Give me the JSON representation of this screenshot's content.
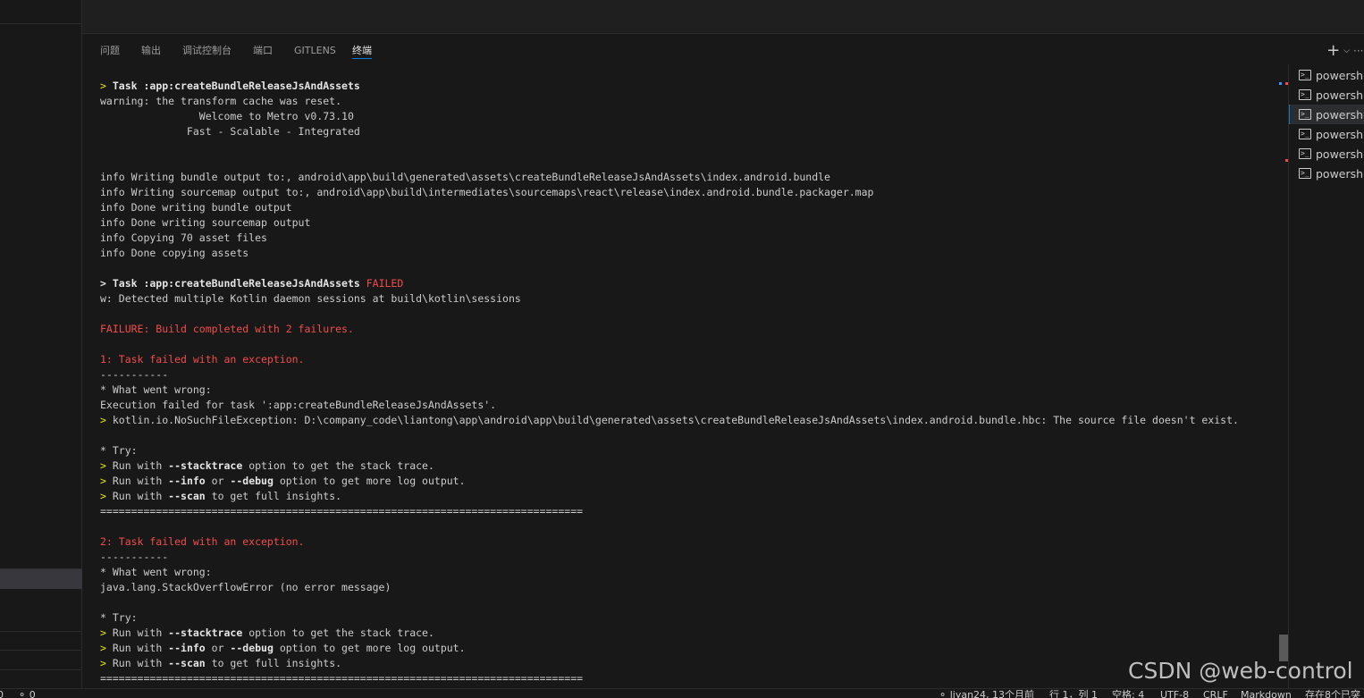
{
  "panel": {
    "tabs": [
      {
        "label": "问题"
      },
      {
        "label": "输出"
      },
      {
        "label": "调试控制台"
      },
      {
        "label": "端口"
      },
      {
        "label": "GITLENS"
      },
      {
        "label": "终端",
        "active": true
      }
    ],
    "actions": {
      "new_terminal": "+",
      "dropdown": "⌵",
      "more": "···"
    }
  },
  "terminal": {
    "lines": [
      [
        {
          "t": "> ",
          "c": "y"
        },
        {
          "t": "Task :app:createBundleReleaseJsAndAssets",
          "c": "b"
        }
      ],
      [
        {
          "t": "warning: the transform cache was reset."
        }
      ],
      [
        {
          "t": "                Welcome to Metro v0.73.10"
        }
      ],
      [
        {
          "t": "              Fast - Scalable - Integrated"
        }
      ],
      [],
      [],
      [
        {
          "t": "info Writing bundle output to:, android\\app\\build\\generated\\assets\\createBundleReleaseJsAndAssets\\index.android.bundle"
        }
      ],
      [
        {
          "t": "info Writing sourcemap output to:, android\\app\\build\\intermediates\\sourcemaps\\react\\release\\index.android.bundle.packager.map"
        }
      ],
      [
        {
          "t": "info Done writing bundle output"
        }
      ],
      [
        {
          "t": "info Done writing sourcemap output"
        }
      ],
      [
        {
          "t": "info Copying 70 asset files"
        }
      ],
      [
        {
          "t": "info Done copying assets"
        }
      ],
      [],
      [
        {
          "t": "> Task :app:createBundleReleaseJsAndAssets",
          "c": "rb"
        },
        {
          "t": " FAILED",
          "c": "r"
        }
      ],
      [
        {
          "t": "w: Detected multiple Kotlin daemon sessions at build\\kotlin\\sessions"
        }
      ],
      [],
      [
        {
          "t": "FAILURE: Build completed with 2 failures.",
          "c": "r"
        }
      ],
      [],
      [
        {
          "t": "1: Task failed with an exception.",
          "c": "r"
        }
      ],
      [
        {
          "t": "-----------"
        }
      ],
      [
        {
          "t": "* What went wrong:"
        }
      ],
      [
        {
          "t": "Execution failed for task ':app:createBundleReleaseJsAndAssets'."
        }
      ],
      [
        {
          "t": "> ",
          "c": "y"
        },
        {
          "t": "kotlin.io.NoSuchFileException: D:\\company_code\\liantong\\app\\android\\app\\build\\generated\\assets\\createBundleReleaseJsAndAssets\\index.android.bundle.hbc: The source file doesn't exist."
        }
      ],
      [],
      [
        {
          "t": "* Try:"
        }
      ],
      [
        {
          "t": "> ",
          "c": "y"
        },
        {
          "t": "Run with "
        },
        {
          "t": "--stacktrace",
          "c": "b"
        },
        {
          "t": " option to get the stack trace."
        }
      ],
      [
        {
          "t": "> ",
          "c": "y"
        },
        {
          "t": "Run with "
        },
        {
          "t": "--info",
          "c": "b"
        },
        {
          "t": " or "
        },
        {
          "t": "--debug",
          "c": "b"
        },
        {
          "t": " option to get more log output."
        }
      ],
      [
        {
          "t": "> ",
          "c": "y"
        },
        {
          "t": "Run with "
        },
        {
          "t": "--scan",
          "c": "b"
        },
        {
          "t": " to get full insights."
        }
      ],
      [
        {
          "t": "=============================================================================="
        }
      ],
      [],
      [
        {
          "t": "2: Task failed with an exception.",
          "c": "r"
        }
      ],
      [
        {
          "t": "-----------"
        }
      ],
      [
        {
          "t": "* What went wrong:"
        }
      ],
      [
        {
          "t": "java.lang.StackOverflowError (no error message)"
        }
      ],
      [],
      [
        {
          "t": "* Try:"
        }
      ],
      [
        {
          "t": "> ",
          "c": "y"
        },
        {
          "t": "Run with "
        },
        {
          "t": "--stacktrace",
          "c": "b"
        },
        {
          "t": " option to get the stack trace."
        }
      ],
      [
        {
          "t": "> ",
          "c": "y"
        },
        {
          "t": "Run with "
        },
        {
          "t": "--info",
          "c": "b"
        },
        {
          "t": " or "
        },
        {
          "t": "--debug",
          "c": "b"
        },
        {
          "t": " option to get more log output."
        }
      ],
      [
        {
          "t": "> ",
          "c": "y"
        },
        {
          "t": "Run with "
        },
        {
          "t": "--scan",
          "c": "b"
        },
        {
          "t": " to get full insights."
        }
      ],
      [
        {
          "t": "=============================================================================="
        }
      ]
    ]
  },
  "terminal_list": {
    "items": [
      {
        "label": "powershell"
      },
      {
        "label": "powershell"
      },
      {
        "label": "powershell",
        "active": true
      },
      {
        "label": "powershell"
      },
      {
        "label": "powershell"
      },
      {
        "label": "powershell"
      }
    ]
  },
  "statusbar": {
    "left": [
      "0",
      "⚬ 0"
    ],
    "right": [
      "⚬ liyan24, 13个月前",
      "行 1，列 1",
      "空格: 4",
      "UTF-8",
      "CRLF",
      "Markdown",
      "存在8个已突"
    ]
  },
  "watermark": "CSDN @web-control",
  "colors": {
    "accent": "#0078d4",
    "error": "#f14c4c",
    "warning": "#e5e510",
    "background": "#181818"
  }
}
